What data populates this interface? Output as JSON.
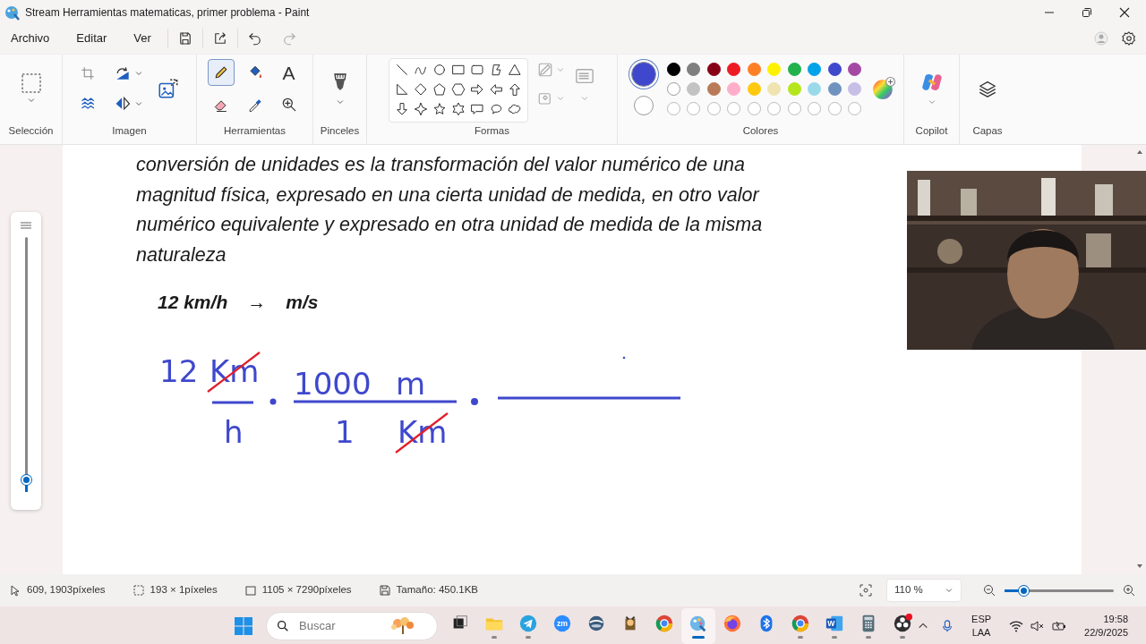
{
  "window": {
    "title": "Stream Herramientas matematicas, primer problema - Paint"
  },
  "menu": [
    "Archivo",
    "Editar",
    "Ver"
  ],
  "quick_actions": {
    "redo": {
      "disabled": true
    }
  },
  "ribbon": {
    "groups": [
      {
        "label": "Selección"
      },
      {
        "label": "Imagen"
      },
      {
        "label": "Herramientas"
      },
      {
        "label": "Pinceles"
      },
      {
        "label": "Formas"
      },
      {
        "label": "Colores"
      },
      {
        "label": "Copilot"
      },
      {
        "label": "Capas"
      }
    ],
    "tools": [
      {
        "kind": "pencil",
        "selected": true
      },
      {
        "kind": "fill",
        "selected": false
      },
      {
        "kind": "text",
        "label": "A",
        "selected": false
      },
      {
        "kind": "eraser",
        "selected": false
      },
      {
        "kind": "picker",
        "selected": false
      },
      {
        "kind": "magnifier",
        "selected": false
      }
    ],
    "primary_color": {
      "color": "#3f48cc",
      "selected": true
    },
    "secondary_color": {
      "color": "#ffffff",
      "selected": false
    },
    "palette": [
      {
        "color": "#000000"
      },
      {
        "color": "#7f7f7f"
      },
      {
        "color": "#880015"
      },
      {
        "color": "#ed1c24"
      },
      {
        "color": "#ff7f27"
      },
      {
        "color": "#fff200"
      },
      {
        "color": "#22b14c"
      },
      {
        "color": "#00a2e8"
      },
      {
        "color": "#3f48cc"
      },
      {
        "color": "#a349a4"
      },
      {
        "color": "#ffffff"
      },
      {
        "color": "#c3c3c3"
      },
      {
        "color": "#b97a57"
      },
      {
        "color": "#ffaec9"
      },
      {
        "color": "#ffc90e"
      },
      {
        "color": "#efe4b0"
      },
      {
        "color": "#b5e61d"
      },
      {
        "color": "#99d9ea"
      },
      {
        "color": "#7092be"
      },
      {
        "color": "#c8bfe7"
      },
      {
        "kind": "empty"
      },
      {
        "kind": "empty"
      },
      {
        "kind": "empty"
      },
      {
        "kind": "empty"
      },
      {
        "kind": "empty"
      },
      {
        "kind": "empty"
      },
      {
        "kind": "empty"
      },
      {
        "kind": "empty"
      },
      {
        "kind": "empty"
      },
      {
        "kind": "empty"
      }
    ]
  },
  "document": {
    "lines": [
      "conversión de unidades es la transformación del valor numérico de una",
      "magnitud física, expresado en una cierta unidad de medida, en otro valor",
      "numérico equivalente y expresado en otra unidad de medida de la misma",
      "naturaleza"
    ],
    "formula": [
      "12 km/h",
      "→",
      "m/s"
    ],
    "handwriting": [
      {
        "text": "12",
        "struck": false
      },
      {
        "text": "Km",
        "struck": true
      },
      {
        "text": "1000",
        "struck": false
      },
      {
        "text": "m",
        "struck": false
      },
      {
        "text": "h",
        "struck": false
      },
      {
        "text": "1",
        "struck": false
      },
      {
        "text": "Km",
        "struck": true
      }
    ]
  },
  "zoom_slider": {
    "level": 0.05
  },
  "webcam": {
    "kind": "picture"
  },
  "status_bar": {
    "position": "609, 1903píxeles",
    "selection": "193 × 1píxeles",
    "canvas_size": "1105 × 7290píxeles",
    "file_size": "Tamaño: 450.1KB",
    "zoom": "110 %",
    "zoom_level": {
      "level": 0.17
    }
  },
  "taskbar": {
    "search_placeholder": "Buscar",
    "apps": [
      {
        "kind": "task-view",
        "running": false,
        "selected": false
      },
      {
        "kind": "folder",
        "running": true,
        "selected": false
      },
      {
        "kind": "telegram",
        "running": true,
        "selected": false
      },
      {
        "kind": "zoom",
        "label": "zm",
        "running": false,
        "selected": false
      },
      {
        "kind": "vpn",
        "running": false,
        "selected": false
      },
      {
        "kind": "game",
        "running": false,
        "selected": false
      },
      {
        "kind": "chrome",
        "running": false,
        "selected": false
      },
      {
        "kind": "paint",
        "running": true,
        "selected": true
      },
      {
        "kind": "firefox",
        "running": false,
        "selected": false
      },
      {
        "kind": "bluetooth",
        "running": false,
        "selected": false
      },
      {
        "kind": "chrome",
        "running": true,
        "selected": false
      },
      {
        "kind": "word",
        "label": "W",
        "running": true,
        "selected": false
      },
      {
        "kind": "calculator",
        "running": true,
        "selected": false
      },
      {
        "kind": "obs",
        "running": true,
        "selected": false
      }
    ],
    "language": [
      "ESP",
      "LAA"
    ],
    "time": "19:58",
    "date": "22/9/2025"
  }
}
